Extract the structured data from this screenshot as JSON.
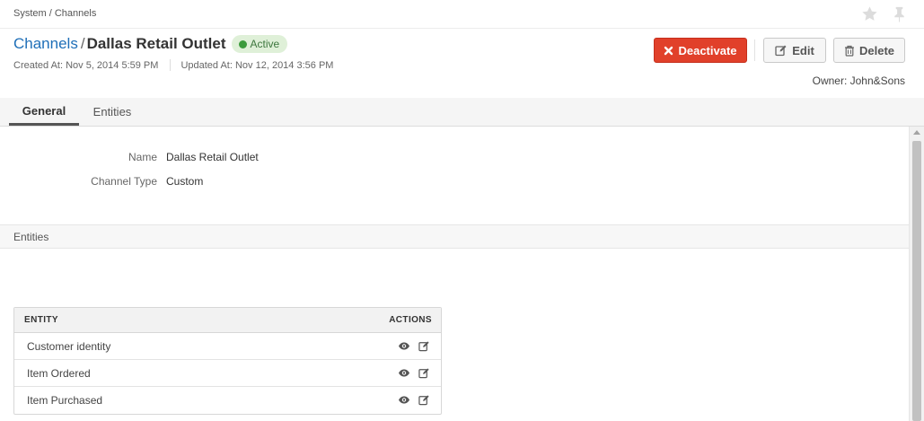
{
  "breadcrumb": "System / Channels",
  "header": {
    "title_link": "Channels",
    "title_separator": "/",
    "title_name": "Dallas Retail Outlet",
    "status": "Active",
    "created_at": "Created At: Nov 5, 2014 5:59 PM",
    "updated_at": "Updated At: Nov 12, 2014 3:56 PM",
    "owner": "Owner: John&Sons"
  },
  "actions": {
    "deactivate_label": "Deactivate",
    "edit_label": "Edit",
    "delete_label": "Delete"
  },
  "tabs": [
    {
      "label": "General",
      "active": true
    },
    {
      "label": "Entities",
      "active": false
    }
  ],
  "general": {
    "fields": [
      {
        "label": "Name",
        "value": "Dallas Retail Outlet"
      },
      {
        "label": "Channel Type",
        "value": "Custom"
      }
    ]
  },
  "entities_section": {
    "title": "Entities",
    "columns": {
      "entity": "ENTITY",
      "actions": "ACTIONS"
    },
    "rows": [
      {
        "name": "Customer identity"
      },
      {
        "name": "Item Ordered"
      },
      {
        "name": "Item Purchased"
      }
    ]
  },
  "icons": [
    "star-icon",
    "pin-icon",
    "close-icon",
    "pencil-square-icon",
    "trash-icon",
    "eye-icon"
  ],
  "colors": {
    "link": "#1f6fb8",
    "deactivate": "#e1402a",
    "status_bg": "#dff0d8",
    "status_dot": "#3c9b3c"
  }
}
